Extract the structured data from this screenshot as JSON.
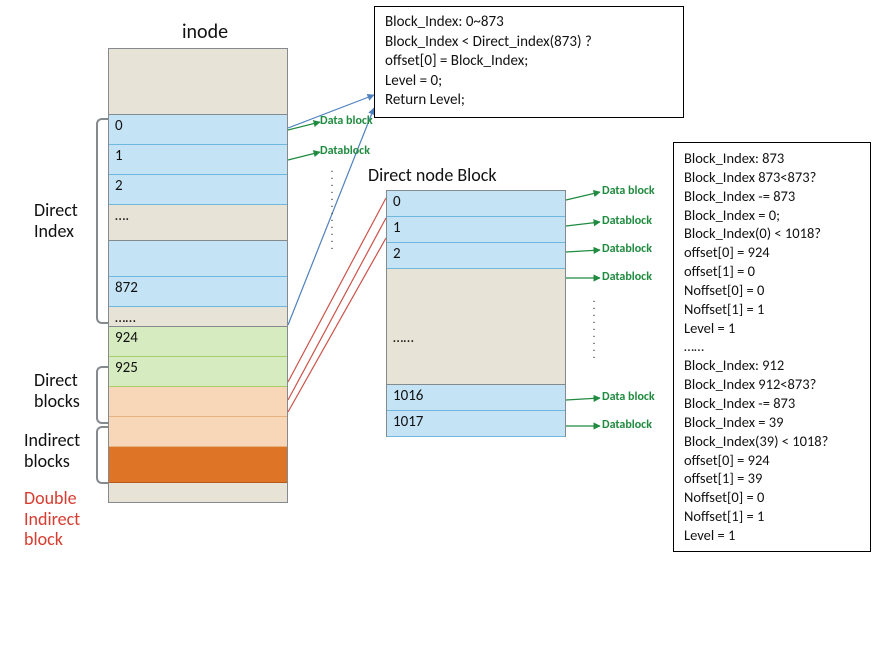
{
  "inode": {
    "title": "inode",
    "rows": {
      "r0": "0",
      "r1": "1",
      "r2": "2",
      "rdots": "….",
      "r872": "872",
      "sep": "……",
      "r924": "924",
      "r925": "925"
    },
    "labels": {
      "direct_index": "Direct\nIndex",
      "direct_blocks": "Direct\nblocks",
      "indirect_blocks": "Indirect\nblocks",
      "double_indirect_block": "Double\nIndirect\nblock"
    }
  },
  "dnode": {
    "title": "Direct node Block",
    "rows": {
      "r0": "0",
      "r1": "1",
      "r2": "2",
      "sep": "……",
      "r1016": "1016",
      "r1017": "1017"
    }
  },
  "db_labels": {
    "data_block": "Data block",
    "datablock": "Datablock"
  },
  "info1": {
    "l1": "Block_Index: 0~873",
    "l2": "Block_Index < Direct_index(873) ?",
    "l3": "offset[0] = Block_Index;",
    "l4": "Level = 0;",
    "l5": "Return Level;"
  },
  "info2": {
    "l1": "Block_Index: 873",
    "l2": "Block_Index 873<873?",
    "l3": "Block_Index -= 873",
    "l4": "Block_Index = 0;",
    "l5": "Block_Index(0) < 1018?",
    "l6": "offset[0] = 924",
    "l7": "offset[1] = 0",
    "l8": "Noffset[0] = 0",
    "l9": "Noffset[1] = 1",
    "l10": "Level = 1",
    "l11": "……",
    "l12": "Block_Index: 912",
    "l13": "Block_Index 912<873?",
    "l14": "Block_Index -= 873",
    "l15": "Block_Index = 39",
    "l16": "Block_Index(39) < 1018?",
    "l17": "offset[0] = 924",
    "l18": "offset[1] = 39",
    "l19": "Noffset[0] = 0",
    "l20": "Noffset[1] = 1",
    "l21": "Level = 1"
  }
}
